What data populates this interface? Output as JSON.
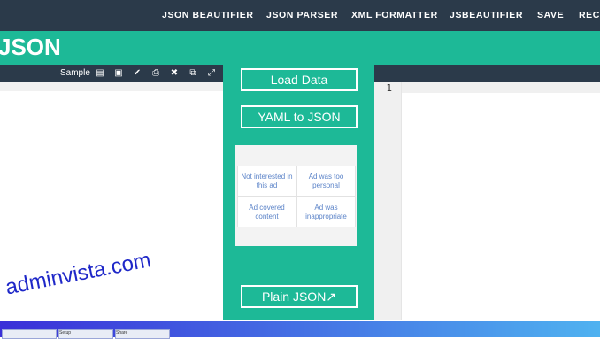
{
  "nav": {
    "items": [
      "JSON BEAUTIFIER",
      "JSON PARSER",
      "XML FORMATTER",
      "JSBEAUTIFIER",
      "SAVE",
      "REC"
    ]
  },
  "header": {
    "title": "JSON"
  },
  "editor_toolbar": {
    "sample_label": "Sample",
    "icons": [
      "folder-open-icon",
      "save-icon",
      "check-icon",
      "print-icon",
      "close-icon",
      "copy-icon",
      "expand-icon"
    ]
  },
  "middle": {
    "load_button": "Load Data",
    "yaml_button": "YAML to JSON",
    "plain_button": "Plain JSON↗",
    "ad_options": [
      "Not interested in this ad",
      "Ad was too personal",
      "Ad covered content",
      "Ad was inappropriate"
    ]
  },
  "right_editor": {
    "line_numbers": [
      "1"
    ]
  },
  "watermark": "adminvista.com",
  "taskbar": {
    "tabs": [
      "",
      "Setup",
      "Share"
    ]
  },
  "colors": {
    "accent": "#1db997",
    "nav": "#2b3a4a"
  }
}
